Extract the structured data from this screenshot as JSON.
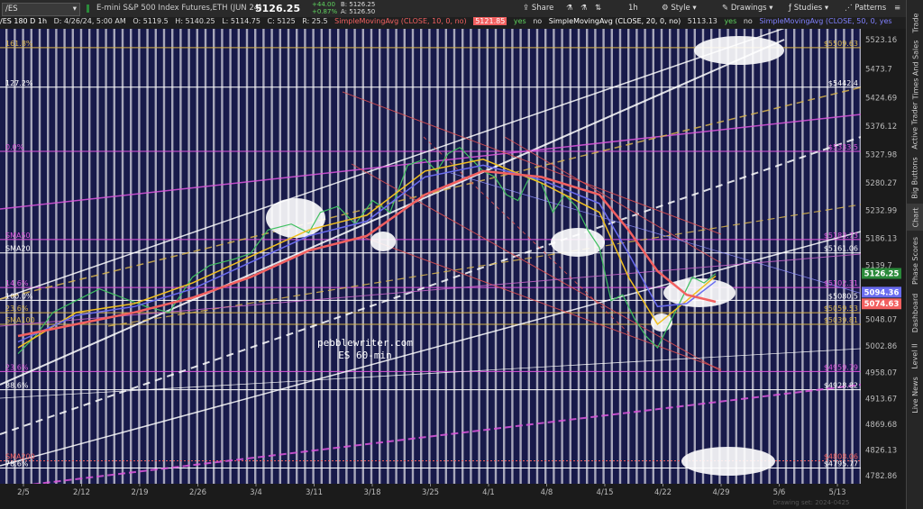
{
  "toolbar": {
    "symbol": "/ES",
    "description": "E-mini S&P 500 Index Futures,ETH (JUN 24)",
    "last_price": "5126.25",
    "net_change": "+44.00",
    "pct_change": "+0.87%",
    "bid": "B: 5126.25",
    "ask": "A: 5126.50",
    "share_label": "Share",
    "interval_label": "1h",
    "style_label": "Style",
    "drawings_label": "Drawings",
    "studies_label": "Studies",
    "patterns_label": "Patterns"
  },
  "info_bar": {
    "symbol_period": "/ES 180 D 1h",
    "date": "D: 4/26/24, 5:00 AM",
    "open": "O: 5119.5",
    "high": "H: 5140.25",
    "low": "L: 5114.75",
    "close": "C: 5125",
    "range": "R: 25.5",
    "sma10": "SimpleMovingAvg (CLOSE, 10, 0, no)",
    "sma10_value": "5121.85",
    "yes": "yes",
    "no": "no",
    "sma20": "SimpleMovingAvg (CLOSE, 20, 0, no)",
    "sma20_value": "5113.13",
    "sma50": "SimpleMovingAvg (CLOSE, 50, 0, yes"
  },
  "right_tabs": [
    "Trade",
    "Times And Sales",
    "Active Trader",
    "Big Buttons",
    "Chart",
    "Phase Scores",
    "Dashboard",
    "Level II",
    "Live News"
  ],
  "watermark": [
    "pebblewriter.com",
    "ES 60-min"
  ],
  "drawing_set": "Drawing set: 2024-0425",
  "colors": {
    "background": "#181a4a",
    "stripe": "#ffffff",
    "price_axis": "#1b1b1b",
    "fib_gold": "#d9b54a",
    "magenta": "#dd55dd",
    "sma10": "#f0c020",
    "sma20": "#6a6cf0",
    "sma50": "#f26060",
    "channel": "#ffffff",
    "red_channel": "#e05050"
  },
  "chart_data": {
    "type": "line",
    "title": "",
    "xlabel": "",
    "ylabel": "",
    "ylim": [
      4770,
      5540
    ],
    "x_ticks": [
      "2/5",
      "2/12",
      "2/19",
      "2/26",
      "3/4",
      "3/11",
      "3/18",
      "3/25",
      "4/1",
      "4/8",
      "4/15",
      "4/22",
      "4/29",
      "5/6",
      "5/13"
    ],
    "y_ticks": [
      5523.16,
      5473.7,
      5424.69,
      5376.12,
      5327.98,
      5280.27,
      5232.99,
      5186.13,
      5139.7,
      5093.66,
      5048.07,
      5002.86,
      4958.07,
      4913.67,
      4869.68,
      4826.13,
      4782.86
    ],
    "series": [
      {
        "name": "price",
        "x": [
          0,
          0.3,
          0.6,
          1,
          1.4,
          1.8,
          2.2,
          2.6,
          3,
          3.3,
          3.7,
          4,
          4.3,
          4.7,
          5,
          5.2,
          5.5,
          5.8,
          6.1,
          6.4,
          6.7,
          7,
          7.2,
          7.4,
          7.6,
          7.8,
          8,
          8.2,
          8.4,
          8.6,
          8.8,
          9,
          9.2,
          9.4,
          9.6,
          9.8,
          10,
          10.2,
          10.4,
          10.6,
          10.8,
          11,
          11.2,
          11.4,
          11.6,
          11.8,
          12
        ],
        "y": [
          4990,
          5020,
          5060,
          5080,
          5100,
          5085,
          5070,
          5060,
          5120,
          5140,
          5150,
          5160,
          5200,
          5210,
          5195,
          5230,
          5240,
          5210,
          5250,
          5230,
          5310,
          5320,
          5300,
          5330,
          5340,
          5320,
          5300,
          5290,
          5260,
          5250,
          5290,
          5280,
          5230,
          5260,
          5240,
          5200,
          5170,
          5080,
          5090,
          5050,
          5020,
          5000,
          5040,
          5080,
          5120,
          5110,
          5126
        ]
      },
      {
        "name": "SMA10",
        "x": [
          0,
          1,
          2,
          3,
          4,
          5,
          6,
          7,
          8,
          9,
          10,
          10.5,
          11,
          11.5,
          12
        ],
        "y": [
          5000,
          5060,
          5075,
          5110,
          5155,
          5200,
          5225,
          5300,
          5320,
          5280,
          5230,
          5120,
          5040,
          5080,
          5122
        ]
      },
      {
        "name": "SMA20",
        "x": [
          0,
          1,
          2,
          3,
          4,
          5,
          6,
          7,
          8,
          9,
          10,
          10.5,
          11,
          11.5,
          12
        ],
        "y": [
          5010,
          5055,
          5070,
          5100,
          5145,
          5190,
          5215,
          5290,
          5310,
          5285,
          5245,
          5160,
          5070,
          5075,
          5113
        ]
      },
      {
        "name": "SMA50",
        "x": [
          0,
          1,
          2,
          3,
          4,
          5,
          6,
          7,
          8,
          9,
          10,
          10.5,
          11,
          11.5,
          12
        ],
        "y": [
          5020,
          5040,
          5060,
          5085,
          5120,
          5165,
          5190,
          5260,
          5300,
          5290,
          5260,
          5200,
          5130,
          5090,
          5078
        ]
      }
    ],
    "price_labels": [
      {
        "text": "$5509.63",
        "value": 5509.63,
        "side": "right",
        "color": "#d9b54a"
      },
      {
        "text": "$5442.4",
        "value": 5442.4,
        "side": "right",
        "color": "#ffffff"
      },
      {
        "text": "$5333.5",
        "value": 5333.5,
        "side": "right",
        "color": "#dd55dd"
      },
      {
        "text": "$5183.73",
        "value": 5183.73,
        "side": "right",
        "color": "#dd55dd"
      },
      {
        "text": "$5161.06",
        "value": 5161.06,
        "side": "right",
        "color": "#ffffff"
      },
      {
        "text": "$5102.31",
        "value": 5102.31,
        "side": "right",
        "color": "#dd55dd"
      },
      {
        "text": "$5080.5",
        "value": 5080.5,
        "side": "right",
        "color": "#ffffff"
      },
      {
        "text": "$5059.53",
        "value": 5059.53,
        "side": "right",
        "color": "#d9b54a"
      },
      {
        "text": "$5039.81",
        "value": 5039.81,
        "side": "right",
        "color": "#d9b54a"
      },
      {
        "text": "$4959.79",
        "value": 4959.79,
        "side": "right",
        "color": "#dd55dd"
      },
      {
        "text": "$4928.82",
        "value": 4928.82,
        "side": "right",
        "color": "#ffffff"
      },
      {
        "text": "$4808.06",
        "value": 4808.06,
        "side": "right",
        "color": "#f26060"
      },
      {
        "text": "$4795.77",
        "value": 4795.77,
        "side": "right",
        "color": "#ffffff"
      }
    ],
    "left_labels": [
      {
        "text": "161.8%",
        "value": 5509.63,
        "color": "#d9b54a"
      },
      {
        "text": "127.2%",
        "value": 5442.4,
        "color": "#ffffff"
      },
      {
        "text": "0.0%",
        "value": 5333.5,
        "color": "#dd55dd"
      },
      {
        "text": "SMA50",
        "value": 5183.73,
        "color": "#dd55dd"
      },
      {
        "text": "SMA20",
        "value": 5161.06,
        "color": "#ffffff"
      },
      {
        "text": "14.6%",
        "value": 5102.31,
        "color": "#dd55dd"
      },
      {
        "text": "100.0%",
        "value": 5080.5,
        "color": "#ffffff"
      },
      {
        "text": "23.6%",
        "value": 5059.53,
        "color": "#d9b54a"
      },
      {
        "text": "SMA100",
        "value": 5039.81,
        "color": "#d9b54a"
      },
      {
        "text": "23.6%",
        "value": 4959.79,
        "color": "#dd55dd"
      },
      {
        "text": "88.6%",
        "value": 4928.82,
        "color": "#ffffff"
      },
      {
        "text": "SMA200",
        "value": 4808.06,
        "color": "#f26060"
      },
      {
        "text": "78.6%",
        "value": 4795.77,
        "color": "#ffffff"
      }
    ],
    "price_badges": [
      {
        "text": "5126.25",
        "value": 5126.25,
        "bg": "#2a8a3a",
        "fg": "#ffffff"
      },
      {
        "text": "5094.36",
        "value": 5094.36,
        "bg": "#6a6cf0",
        "fg": "#ffffff"
      },
      {
        "text": "5074.63",
        "value": 5074.63,
        "bg": "#f26060",
        "fg": "#ffffff"
      }
    ]
  }
}
